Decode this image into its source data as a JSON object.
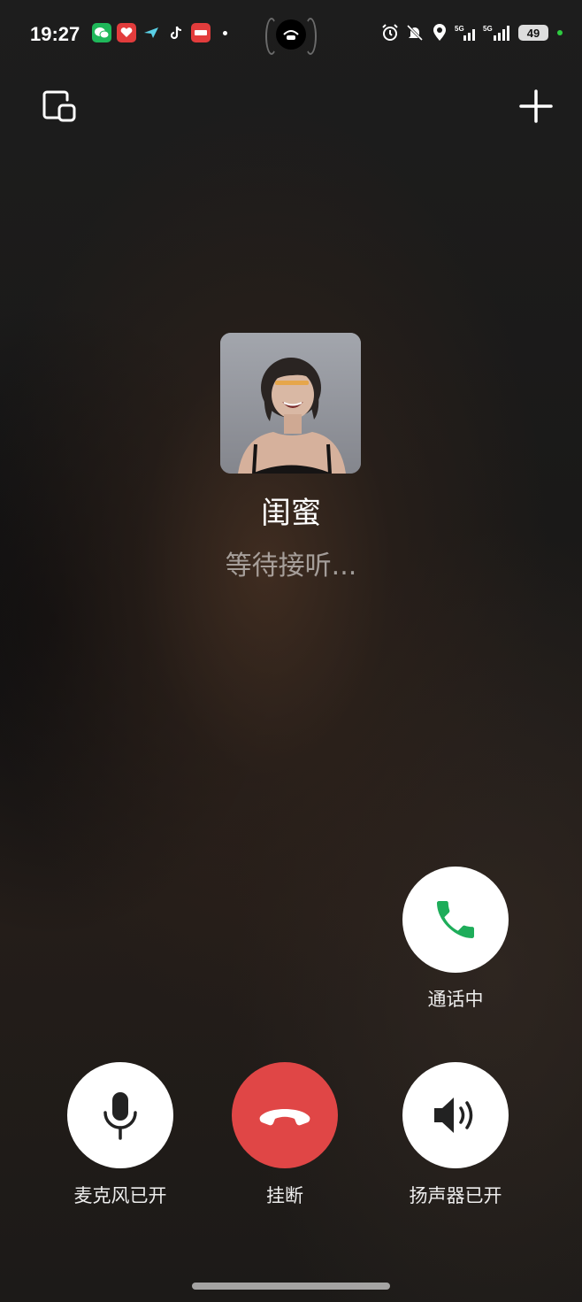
{
  "status_bar": {
    "time": "19:27",
    "battery": "49",
    "app_icons": [
      "wechat-icon",
      "message-icon",
      "send-icon",
      "tiktok-icon",
      "app-icon"
    ],
    "indicator_icons": [
      "alarm-icon",
      "mute-icon",
      "location-icon",
      "5g-signal-icon",
      "5g-signal-icon"
    ]
  },
  "contact": {
    "name": "闺蜜",
    "status": "等待接听..."
  },
  "controls": {
    "call_label": "通话中",
    "mic_label": "麦克风已开",
    "hangup_label": "挂断",
    "speaker_label": "扬声器已开"
  },
  "colors": {
    "hangup": "#e04646",
    "call_green": "#1ead5a",
    "status_dot": "#2ecc40"
  }
}
